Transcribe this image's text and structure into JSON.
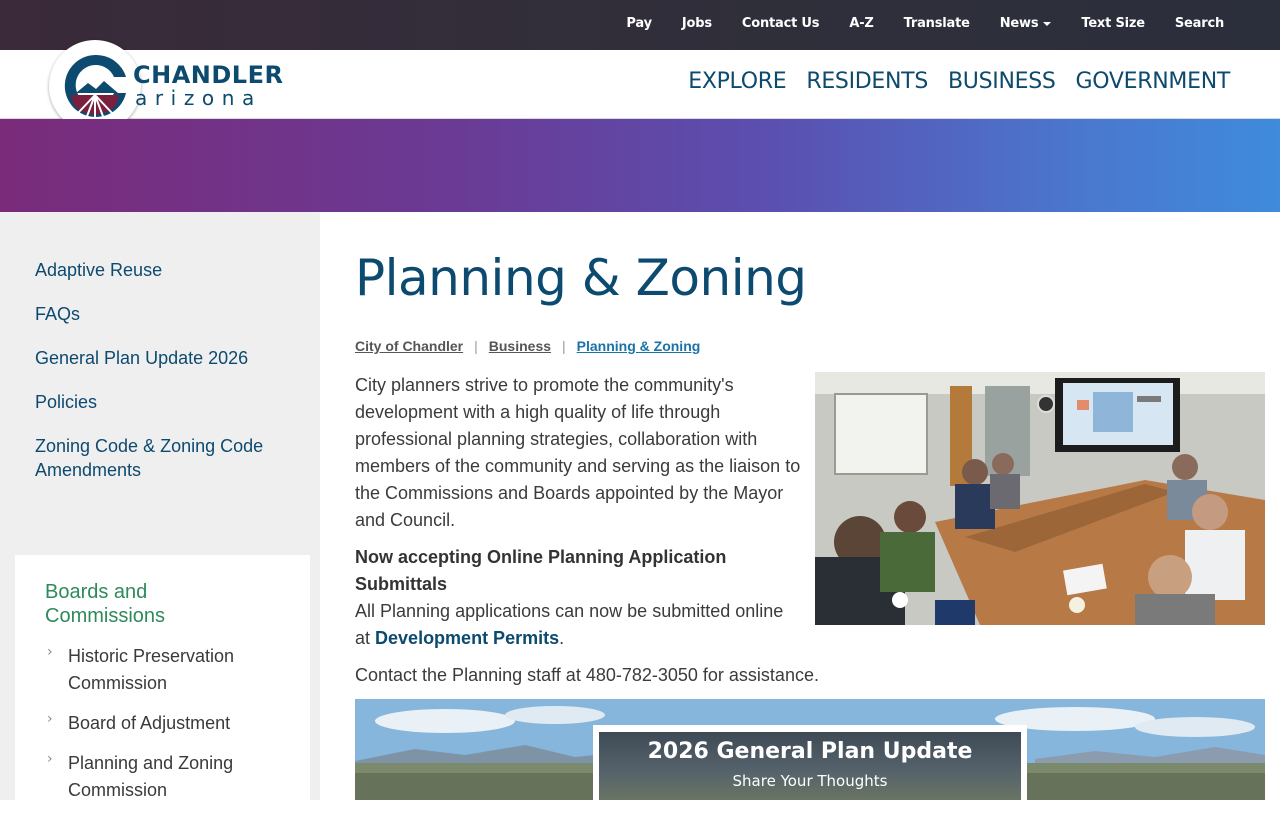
{
  "utility_nav": [
    {
      "label": "Pay"
    },
    {
      "label": "Jobs"
    },
    {
      "label": "Contact Us"
    },
    {
      "label": "A-Z"
    },
    {
      "label": "Translate"
    },
    {
      "label": "News"
    },
    {
      "label": "Text Size"
    },
    {
      "label": "Search"
    }
  ],
  "logo": {
    "name": "CHANDLER",
    "sub": "arizona"
  },
  "main_nav": [
    {
      "label": "EXPLORE"
    },
    {
      "label": "RESIDENTS"
    },
    {
      "label": "BUSINESS"
    },
    {
      "label": "GOVERNMENT"
    }
  ],
  "sidebar": {
    "items": [
      {
        "label": "Adaptive Reuse"
      },
      {
        "label": "FAQs"
      },
      {
        "label": "General Plan Update 2026"
      },
      {
        "label": "Policies"
      },
      {
        "label": "Zoning Code & Zoning Code Amendments"
      }
    ],
    "boards": {
      "title": "Boards and Commissions",
      "items": [
        {
          "label": "Historic Preservation Commission"
        },
        {
          "label": "Board of Adjustment"
        },
        {
          "label": "Planning and Zoning Commission"
        }
      ]
    }
  },
  "page": {
    "title": "Planning & Zoning",
    "breadcrumb": [
      "City of Chandler",
      "Business",
      "Planning & Zoning"
    ],
    "intro": "City planners strive to promote the community's development with a high quality of life through professional planning strategies, collaboration with members of the community and serving as the liaison to the Commissions and Boards appointed by the Mayor and Council.",
    "notice_heading": "Now accepting Online Planning Application Submittals",
    "notice_text": "All Planning applications can now be submitted online at",
    "notice_link": "Development Permits",
    "notice_end": ".",
    "contact": "Contact the Planning staff at 480-782-3050 for assistance."
  },
  "banner": {
    "title": "2026 General Plan Update",
    "subtitle": "Share Your Thoughts"
  },
  "colors": {
    "brand": "#0d4a6f",
    "accent_green": "#2f8a5a",
    "link_blue": "#1a73a8",
    "logo_maroon": "#7a1f3d"
  }
}
